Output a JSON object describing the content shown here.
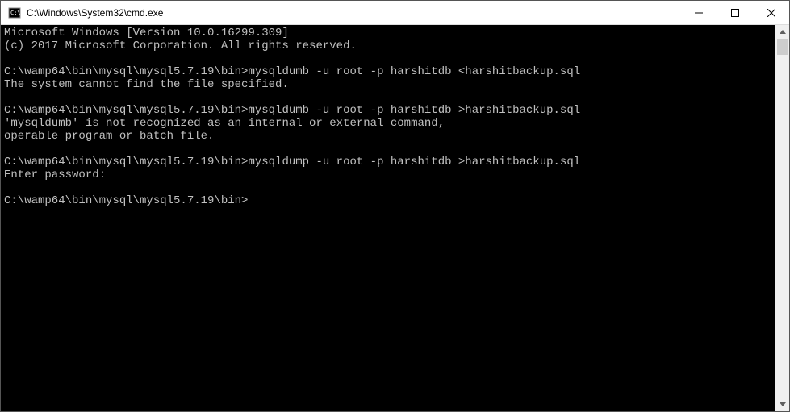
{
  "titlebar": {
    "title": "C:\\Windows\\System32\\cmd.exe"
  },
  "console": {
    "lines": [
      "Microsoft Windows [Version 10.0.16299.309]",
      "(c) 2017 Microsoft Corporation. All rights reserved.",
      "",
      "C:\\wamp64\\bin\\mysql\\mysql5.7.19\\bin>mysqldumb -u root -p harshitdb <harshitbackup.sql",
      "The system cannot find the file specified.",
      "",
      "C:\\wamp64\\bin\\mysql\\mysql5.7.19\\bin>mysqldumb -u root -p harshitdb >harshitbackup.sql",
      "'mysqldumb' is not recognized as an internal or external command,",
      "operable program or batch file.",
      "",
      "C:\\wamp64\\bin\\mysql\\mysql5.7.19\\bin>mysqldump -u root -p harshitdb >harshitbackup.sql",
      "Enter password:",
      "",
      "C:\\wamp64\\bin\\mysql\\mysql5.7.19\\bin>"
    ]
  }
}
